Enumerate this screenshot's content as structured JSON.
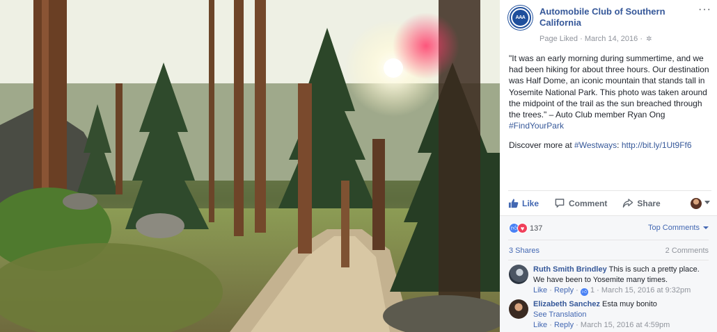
{
  "post": {
    "page_name": "Automobile Club of Southern California",
    "avatar_text": "AAA",
    "liked_label": "Page Liked",
    "date": "March 14, 2016",
    "body_text": "\"It was an early morning during summertime, and we had been hiking for about three hours. Our destination was Half Dome, an iconic mountain that stands tall in Yosemite National Park. This photo was taken around the midpoint of the trail as the sun breached through the trees.\" – Auto Club member Ryan Ong ",
    "body_hashtag": "#FindYourPark",
    "discover_prefix": "Discover more at ",
    "discover_hashtag": "#Westways",
    "discover_colon": ": ",
    "discover_link": "http://bit.ly/1Ut9Ff6"
  },
  "actions": {
    "like": "Like",
    "comment": "Comment",
    "share": "Share"
  },
  "stats": {
    "reaction_count": "137",
    "top_comments": "Top Comments",
    "shares": "3 Shares",
    "comments": "2 Comments"
  },
  "comments": [
    {
      "author": "Ruth Smith Brindley",
      "text": "This is such a pretty place. We have been to Yosemite many times.",
      "like": "Like",
      "reply": "Reply",
      "likes": "1",
      "timestamp": "March 15, 2016 at 9:32pm"
    },
    {
      "author": "Elizabeth Sanchez",
      "text": "Esta muy bonito",
      "see_translation": "See Translation",
      "like": "Like",
      "reply": "Reply",
      "timestamp": "March 15, 2016 at 4:59pm"
    }
  ],
  "colors": {
    "link_blue": "#365899",
    "action_blue": "#4267b2",
    "muted_gray": "#90949c"
  }
}
